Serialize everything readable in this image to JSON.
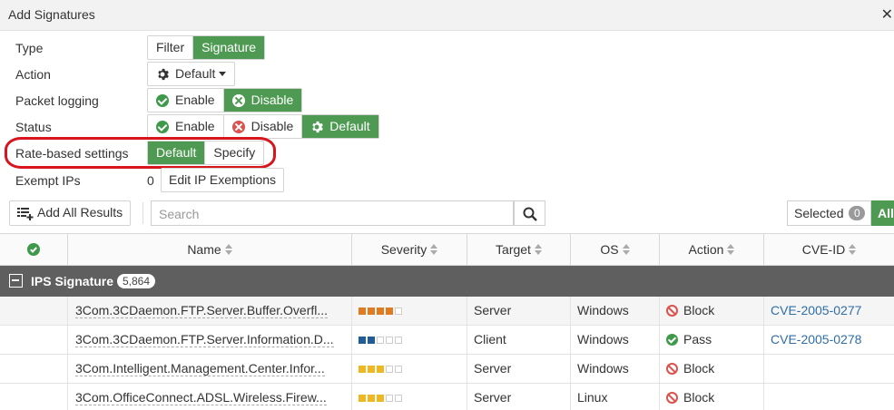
{
  "window": {
    "title": "Add Signatures",
    "close_label": "✕"
  },
  "form": {
    "type": {
      "label": "Type",
      "options": [
        "Filter",
        "Signature"
      ],
      "active": 1
    },
    "action": {
      "label": "Action",
      "value": "Default"
    },
    "packet_logging": {
      "label": "Packet logging",
      "options": [
        "Enable",
        "Disable"
      ],
      "active": 1
    },
    "status": {
      "label": "Status",
      "options": [
        "Enable",
        "Disable",
        "Default"
      ],
      "active": 2
    },
    "rate_based": {
      "label": "Rate-based settings",
      "options": [
        "Default",
        "Specify"
      ],
      "active": 0
    },
    "exempt_ips": {
      "label": "Exempt IPs",
      "count": "0",
      "button": "Edit IP Exemptions"
    }
  },
  "colors": {
    "active": "#4f9a52",
    "highlight": "#d8151d",
    "group_bg": "#5f5f5f",
    "link": "#2f6da8"
  },
  "toolbar": {
    "add_all": "Add All Results",
    "search_placeholder": "Search",
    "selected_label": "Selected",
    "selected_count": "0",
    "all_label": "All"
  },
  "table": {
    "columns": [
      "Name",
      "Severity",
      "Target",
      "OS",
      "Action",
      "CVE-ID"
    ],
    "group": {
      "title": "IPS Signature",
      "count": "5,864"
    },
    "rows": [
      {
        "name": "3Com.3CDaemon.FTP.Server.Buffer.Overfl...",
        "severity": 4,
        "severity_color": "#e07b22",
        "target": "Server",
        "os": "Windows",
        "action": "Block",
        "cve": "CVE-2005-0277"
      },
      {
        "name": "3Com.3CDaemon.FTP.Server.Information.D...",
        "severity": 2,
        "severity_color": "#1f5d99",
        "target": "Client",
        "os": "Windows",
        "action": "Pass",
        "cve": "CVE-2005-0278"
      },
      {
        "name": "3Com.Intelligent.Management.Center.Infor...",
        "severity": 3,
        "severity_color": "#f0b722",
        "target": "Server",
        "os": "Windows",
        "action": "Block",
        "cve": ""
      },
      {
        "name": "3Com.OfficeConnect.ADSL.Wireless.Firew...",
        "severity": 3,
        "severity_color": "#f0b722",
        "target": "Server",
        "os": "Linux",
        "action": "Block",
        "cve": ""
      }
    ]
  }
}
